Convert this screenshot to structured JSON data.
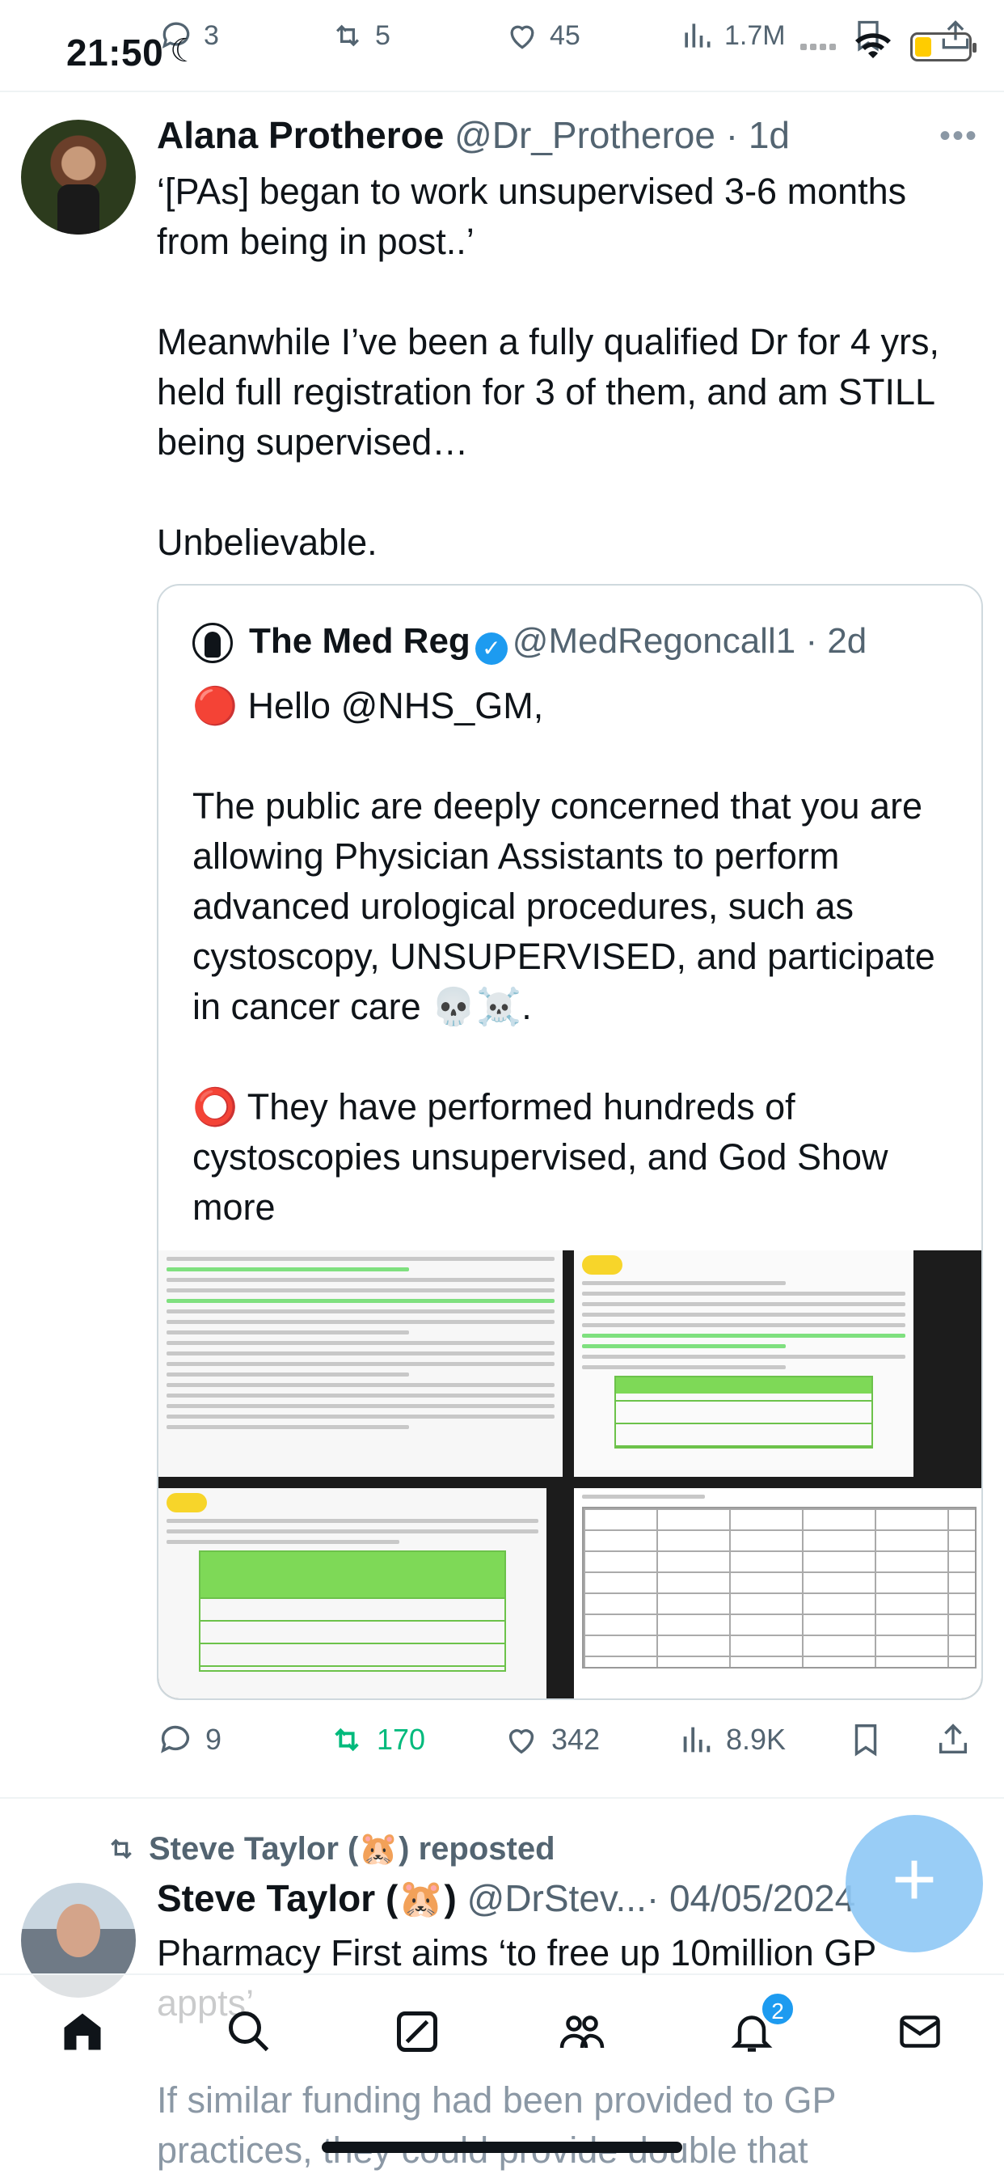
{
  "status_bar": {
    "time": "21:50",
    "ghost_counts": {
      "replies": "3",
      "reposts": "5",
      "likes": "45",
      "views": "1.7M"
    }
  },
  "tweet": {
    "author_name": "Alana Protheroe",
    "handle": "@Dr_Protheroe",
    "age": "· 1d",
    "text": "‘[PAs] began to work unsupervised 3-6 months from being in post..’\n\nMeanwhile I’ve been a fully qualified Dr for 4 yrs, held full registration for 3 of them, and am STILL being supervised…\n\nUnbelievable.",
    "quote": {
      "author_name": "The Med Reg",
      "handle": "@MedRegoncall1",
      "age": "· 2d",
      "text": "🔴 Hello @NHS_GM,\n\nThe public are deeply concerned that you are allowing Physician Assistants to perform advanced urological procedures, such as cystoscopy, UNSUPERVISED, and participate in cancer care 💀☠️.\n\n⭕ They have performed hundreds of cystoscopies unsupervised, and God",
      "show_more": "Show more"
    },
    "actions": {
      "replies": "9",
      "reposts": "170",
      "likes": "342",
      "views": "8.9K"
    }
  },
  "repost": {
    "reposted_by": "Steve Taylor (🐹) reposted",
    "author_name": "Steve Taylor (🐹)",
    "handle": "@DrStev...",
    "date": "· 04/05/2024",
    "text": "Pharmacy First aims ‘to free up 10million GP appts’",
    "continued_text": "If similar funding had been provided to GP practices, they could provide double that"
  },
  "tabbar": {
    "notification_count": "2"
  },
  "colors": {
    "accent": "#1d9bf0",
    "repost_green": "#00ba7c",
    "secondary_text": "#536471"
  }
}
